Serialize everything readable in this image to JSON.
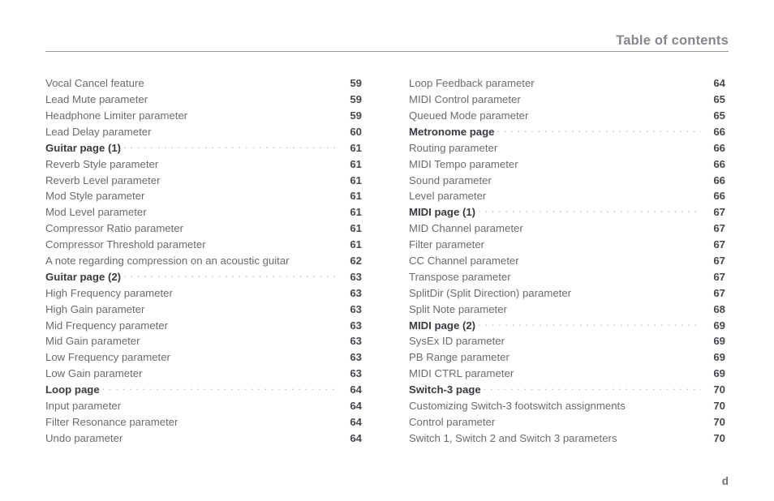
{
  "header": {
    "title": "Table of contents"
  },
  "footer": {
    "folio": "d"
  },
  "toc": {
    "left_column": [
      {
        "label": "Vocal Cancel feature",
        "page": "59",
        "heading": false
      },
      {
        "label": "Lead Mute parameter",
        "page": "59",
        "heading": false
      },
      {
        "label": "Headphone Limiter parameter",
        "page": "59",
        "heading": false
      },
      {
        "label": "Lead Delay parameter",
        "page": "60",
        "heading": false
      },
      {
        "label": "Guitar page (1)",
        "page": "61",
        "heading": true
      },
      {
        "label": "Reverb Style parameter",
        "page": "61",
        "heading": false
      },
      {
        "label": "Reverb Level parameter",
        "page": "61",
        "heading": false
      },
      {
        "label": "Mod Style parameter",
        "page": "61",
        "heading": false
      },
      {
        "label": "Mod Level parameter",
        "page": "61",
        "heading": false
      },
      {
        "label": "Compressor Ratio parameter",
        "page": "61",
        "heading": false
      },
      {
        "label": "Compressor Threshold parameter",
        "page": "61",
        "heading": false
      },
      {
        "label": "A note regarding compression on an acoustic guitar",
        "page": "62",
        "heading": false
      },
      {
        "label": "Guitar page (2)",
        "page": "63",
        "heading": true
      },
      {
        "label": "High Frequency parameter",
        "page": "63",
        "heading": false
      },
      {
        "label": "High Gain parameter",
        "page": "63",
        "heading": false
      },
      {
        "label": "Mid Frequency parameter",
        "page": "63",
        "heading": false
      },
      {
        "label": "Mid Gain parameter",
        "page": "63",
        "heading": false
      },
      {
        "label": "Low Frequency parameter",
        "page": "63",
        "heading": false
      },
      {
        "label": "Low Gain parameter",
        "page": "63",
        "heading": false
      },
      {
        "label": "Loop page",
        "page": "64",
        "heading": true
      },
      {
        "label": "Input parameter",
        "page": "64",
        "heading": false
      },
      {
        "label": "Filter Resonance parameter",
        "page": "64",
        "heading": false
      },
      {
        "label": "Undo parameter",
        "page": "64",
        "heading": false
      }
    ],
    "right_column": [
      {
        "label": "Loop Feedback parameter",
        "page": "64",
        "heading": false
      },
      {
        "label": "MIDI Control parameter",
        "page": "65",
        "heading": false
      },
      {
        "label": "Queued Mode parameter",
        "page": "65",
        "heading": false
      },
      {
        "label": "Metronome page",
        "page": "66",
        "heading": true
      },
      {
        "label": "Routing parameter",
        "page": "66",
        "heading": false
      },
      {
        "label": "MIDI Tempo parameter",
        "page": "66",
        "heading": false
      },
      {
        "label": "Sound parameter",
        "page": "66",
        "heading": false
      },
      {
        "label": "Level parameter",
        "page": "66",
        "heading": false
      },
      {
        "label": "MIDI page (1)",
        "page": "67",
        "heading": true
      },
      {
        "label": "MID Channel parameter",
        "page": "67",
        "heading": false
      },
      {
        "label": "Filter parameter",
        "page": "67",
        "heading": false
      },
      {
        "label": "CC Channel parameter",
        "page": "67",
        "heading": false
      },
      {
        "label": "Transpose parameter",
        "page": "67",
        "heading": false
      },
      {
        "label": "SplitDir (Split Direction) parameter",
        "page": "67",
        "heading": false
      },
      {
        "label": "Split Note parameter",
        "page": "68",
        "heading": false
      },
      {
        "label": "MIDI page (2)",
        "page": "69",
        "heading": true
      },
      {
        "label": "SysEx ID parameter",
        "page": "69",
        "heading": false
      },
      {
        "label": "PB Range parameter",
        "page": "69",
        "heading": false
      },
      {
        "label": "MIDI CTRL parameter",
        "page": "69",
        "heading": false
      },
      {
        "label": "Switch-3 page",
        "page": "70",
        "heading": true
      },
      {
        "label": "Customizing Switch-3 footswitch assignments",
        "page": "70",
        "heading": false
      },
      {
        "label": "Control parameter",
        "page": "70",
        "heading": false
      },
      {
        "label": "Switch 1, Switch 2 and Switch 3 parameters",
        "page": "70",
        "heading": false
      }
    ]
  },
  "colors": {
    "body_text": "#6b6b70",
    "heading_text": "#3a3a40",
    "page_number": "#48484e",
    "header_title": "#86868c",
    "rule": "#9a9aa0",
    "leader_dots": "#b6b6bb",
    "background": "#ffffff"
  }
}
